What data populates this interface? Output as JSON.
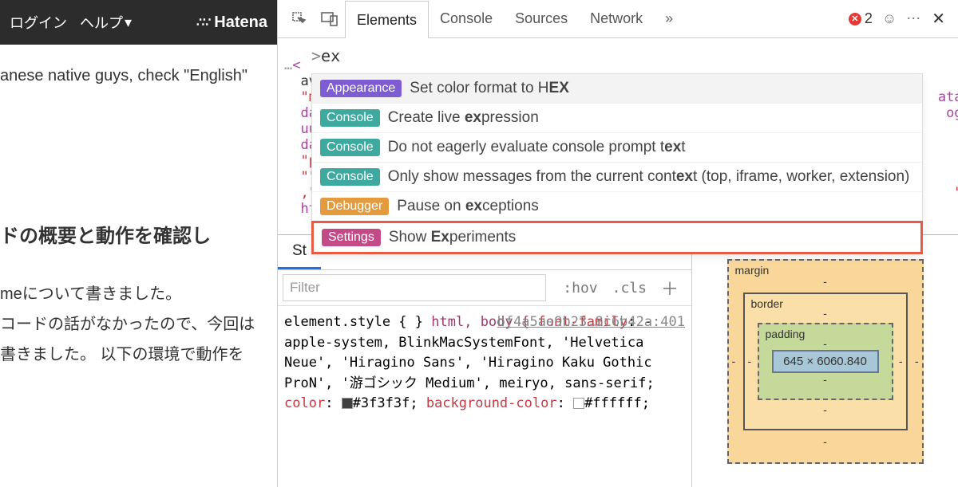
{
  "header": {
    "login": "ログイン",
    "help": "ヘルプ",
    "brand": "Hatena"
  },
  "page": {
    "line1": "anese native guys, check \"English\"",
    "heading": "ドの概要と動作を確認し",
    "body1": "meについて書きました。",
    "body2": "コードの話がなかったので、今回は",
    "body3": "書きました。 以下の環境で動作を"
  },
  "devtools": {
    "tabs": {
      "elements": "Elements",
      "console": "Console",
      "sources": "Sources",
      "network": "Network"
    },
    "error_count": "2"
  },
  "code": {
    "l1_pre": "…",
    "l1_tag": "<",
    "l2": "ava",
    "l3": "\"ma",
    "l3b": "ata-",
    "l4": "dat",
    "l4b": "og-",
    "l5": "uui",
    "l5b": "\"",
    "l6": "dat",
    "l7": "\"pr",
    "l8": "\"\"",
    "l9": ",\"a",
    "l9b": "\":",
    "l10": "htm"
  },
  "cmd": {
    "prefix": ">",
    "query": "ex",
    "items": [
      {
        "badge": "Appearance",
        "badgeColor": "b-violet",
        "pre": "Set color format to H",
        "match": "EX",
        "post": ""
      },
      {
        "badge": "Console",
        "badgeColor": "b-teal",
        "pre": "Create live ",
        "match": "ex",
        "post": "pression"
      },
      {
        "badge": "Console",
        "badgeColor": "b-teal",
        "pre": "Do not eagerly evaluate console prompt t",
        "match": "ex",
        "post": "t"
      },
      {
        "badge": "Console",
        "badgeColor": "b-teal",
        "pre": "Only show messages from the current cont",
        "match": "ex",
        "post": "t (top, iframe, worker, extension)"
      },
      {
        "badge": "Debugger",
        "badgeColor": "b-orange",
        "pre": "Pause on ",
        "match": "ex",
        "post": "ceptions"
      },
      {
        "badge": "Settings",
        "badgeColor": "b-magenta",
        "pre": "Show ",
        "match": "Ex",
        "post": "periments"
      }
    ]
  },
  "styles": {
    "tab_styles": "St",
    "filter_placeholder": "Filter",
    "hov": ":hov",
    "cls": ".cls",
    "element_style": "element.style {",
    "close": "}",
    "rule_sel": "html, body {",
    "rule_file": "bf4a5ae9b23…8c6b42a:401",
    "p1_name": "font-family",
    "p1_val": ": -apple-system, BlinkMacSystemFont, 'Helvetica Neue', 'Hiragino Sans', 'Hiragino Kaku Gothic ProN', '游ゴシック Medium', meiryo, sans-serif;",
    "p2_name": "color",
    "p2_val_hex": "#3f3f3f;",
    "p3_name": "background-color",
    "p3_val_hex": "#ffffff;"
  },
  "boxmodel": {
    "margin_label": "margin",
    "border_label": "border",
    "padding_label": "padding",
    "content": "645 × 6060.840",
    "dash": "-"
  }
}
